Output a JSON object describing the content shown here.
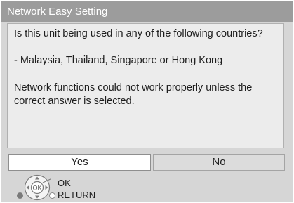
{
  "dialog": {
    "title": "Network Easy Setting",
    "question": "Is this unit being used in any of the following countries?",
    "countries": "- Malaysia, Thailand, Singapore or Hong Kong",
    "warning": "Network functions could not work properly unless the correct answer is selected."
  },
  "buttons": {
    "yes_label": "Yes",
    "no_label": "No",
    "selected": "Yes"
  },
  "guide": {
    "ok_label": "OK",
    "return_label": "RETURN",
    "icons": [
      "dpad-icon",
      "return-dot-icon"
    ]
  },
  "colors": {
    "title_bar": "#9c9c9c",
    "panel_bg": "#d6d6d6",
    "content_bg": "#ececec",
    "selected_button": "#ffffff",
    "unselected_button": "#dcdcdc"
  }
}
